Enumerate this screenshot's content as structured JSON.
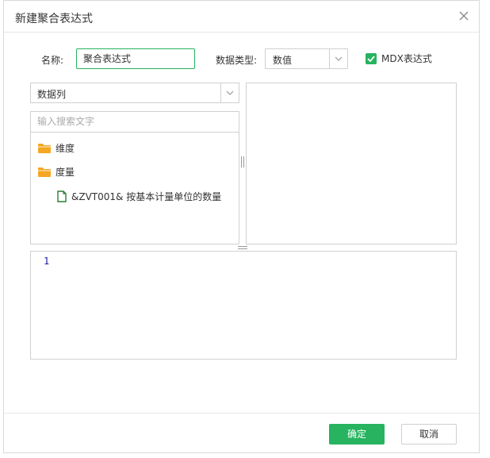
{
  "dialog": {
    "title": "新建聚合表达式",
    "name_label": "名称:",
    "name_value": "聚合表达式",
    "type_label": "数据类型:",
    "type_value": "数值",
    "mdx_label": "MDX表达式",
    "mdx_checked": true
  },
  "left": {
    "column_select": "数据列",
    "search_placeholder": "输入搜索文字",
    "tree": [
      {
        "label": "维度",
        "icon": "folder-icon"
      },
      {
        "label": "度量",
        "icon": "folder-icon"
      },
      {
        "label": "&ZVT001& 按基本计量单位的数量",
        "icon": "file-icon"
      }
    ]
  },
  "editor": {
    "line_number": "1",
    "content": ""
  },
  "footer": {
    "ok_label": "确定",
    "cancel_label": "取消"
  },
  "colors": {
    "accent": "#27b35f",
    "folder": "#f5a623",
    "file": "#2e7d32"
  }
}
